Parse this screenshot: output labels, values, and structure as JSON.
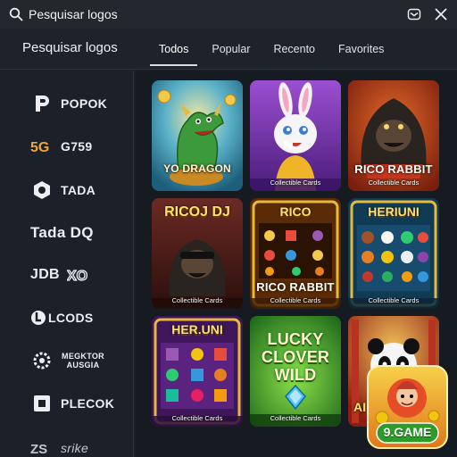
{
  "search": {
    "query": "Pesquisar logos"
  },
  "header": {
    "title": "Pesquisar logos",
    "tabs": [
      "Todos",
      "Popular",
      "Recento",
      "Favorites"
    ]
  },
  "sidebar": {
    "brands": [
      {
        "name": "POPOK",
        "icon": "p-logo-icon"
      },
      {
        "name": "G759",
        "icon": "5g-logo-icon"
      },
      {
        "name": "TADA",
        "icon": "tada-logo-icon"
      },
      {
        "name": "Tada DQ",
        "icon": ""
      },
      {
        "name": "JDB",
        "icon": "xo-logo-icon"
      },
      {
        "name": "LCODS",
        "icon": "l-logo-icon"
      },
      {
        "name": "MEGKTOR AUSGIA",
        "icon": "gear-logo-icon"
      },
      {
        "name": "PLECOK",
        "icon": "plecok-logo-icon"
      },
      {
        "name": "srike",
        "icon": "zs-logo-icon"
      }
    ]
  },
  "games": [
    {
      "title": "YO DRAGON",
      "caption": "",
      "top": ""
    },
    {
      "title": "",
      "caption": "Collectible Cards",
      "top": ""
    },
    {
      "title": "RICO RABBIT",
      "caption": "Collectible Cards",
      "top": ""
    },
    {
      "title": "",
      "caption": "Collectible Cards",
      "top": "RICOJ DJ"
    },
    {
      "title": "RICO RABBIT",
      "caption": "Collectible Cards",
      "top": "RICO"
    },
    {
      "title": "",
      "caption": "Collectible Cards",
      "top": "HERIUNI"
    },
    {
      "title": "",
      "caption": "Collectible Cards",
      "top": "HER.UNI"
    },
    {
      "title": "LUCKY CLOVER WILD",
      "caption": "Collectible Cards",
      "top": ""
    },
    {
      "title": "AI",
      "caption": "",
      "top": ""
    }
  ],
  "badge": {
    "label": "9.GAME"
  },
  "colors": {
    "background": "#1b2029",
    "topbar": "#23282f",
    "grid": "#161a21",
    "tab_underline": "#d7dbe1"
  }
}
